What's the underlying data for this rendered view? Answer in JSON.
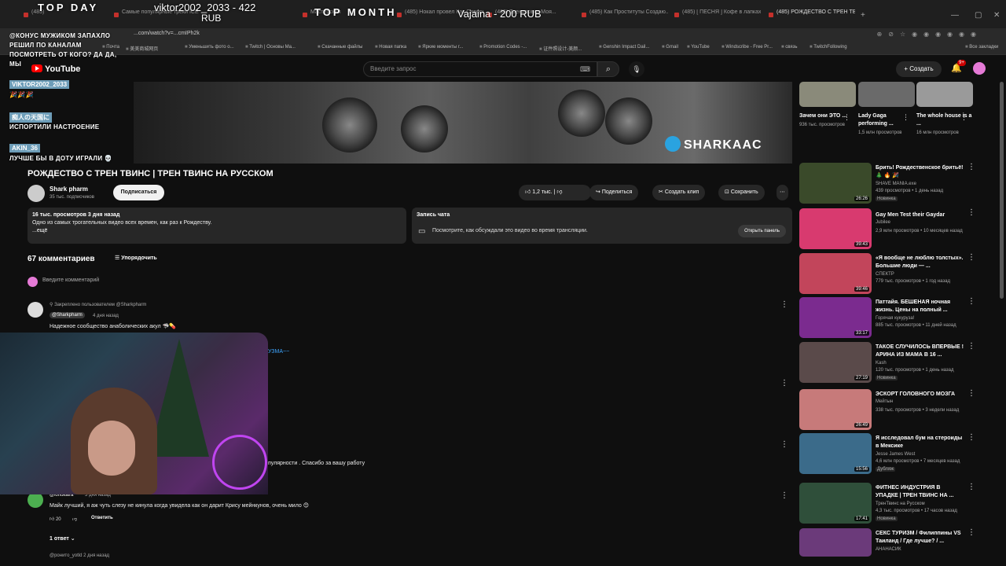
{
  "browser": {
    "tabs": [
      {
        "label": "(485)"
      },
      {
        "label": "Самые популярные треки ICE"
      },
      {
        "label": "Мастерская"
      },
      {
        "label": "(485) Насколько..."
      },
      {
        "label": "(485) Нокал провел Как Северный..."
      },
      {
        "label": "(485) Тренировка Моя..."
      },
      {
        "label": "(485) Как Проституты Создаю..."
      },
      {
        "label": "(485) [ ПЕСНЯ ] Кофе в лапках..."
      },
      {
        "label": "(485) РОЖДЕСТВО С ТРЕН ТВИН"
      }
    ],
    "address": "...com/watch?v=...cmIPh2k",
    "bookmarks": [
      "Почта",
      "美美商城网页",
      "Уменьшить фото о...",
      "Twitch | Основы Ma...",
      "Скачанные файлы",
      "Новая папка",
      "Яркие моменты г...",
      "Promotion Codes -...",
      "证件照设计-美颜...",
      "Genshin Impact Dail...",
      "Gmail",
      "YouTube",
      "Windscribe - Free Pr...",
      "связь",
      "TwitchFollowing",
      "Все закладки"
    ]
  },
  "youtube": {
    "logo": "YouTube",
    "search_placeholder": "Введите запрос",
    "create_label": "+ Создать",
    "notif_count": "9+"
  },
  "video": {
    "watermark": "SHARKAAC",
    "title": "РОЖДЕСТВО С ТРЕН ТВИНС | ТРЕН ТВИНС НА РУССКОМ",
    "channel": "Shark pharm",
    "subscribers": "35 тыс. подписчиков",
    "subscribe_label": "Подписаться",
    "likes": "1,2 тыс.",
    "share_label": "Поделиться",
    "clip_label": "Создать клип",
    "save_label": "Сохранить",
    "description": {
      "meta": "16 тыс. просмотров  3 дня назад",
      "text": "Одно из самых трогательных видео всех времен, как раз к Рождеству.",
      "more": "...ещё"
    },
    "chat_replay": {
      "title": "Запись чата",
      "text": "Посмотрите, как обсуждали это видео во время трансляции.",
      "button": "Открыть панель"
    }
  },
  "comments": {
    "count_label": "67 комментариев",
    "sort_label": "Упорядочить",
    "input_placeholder": "Введите комментарий",
    "pinned": {
      "pinned_by": "Закреплено пользователем @Sharkpharm",
      "author": "@Sharkpharm",
      "time": "4 дня назад",
      "text": "Надежное сообщество анаболических акул 🦈💊"
    },
    "partial_link": "УЗМА~~",
    "partial_text": "пулярности . Спасибо за вашу работу",
    "second": {
      "author": "@lorlokaira",
      "time": "3 дня назад",
      "text": "Майк лучший, я аж чуть слезу не кинула когда увидела как он дарит Криcу мейнкунов, очень мило 😊",
      "likes": "20",
      "reply_label": "Ответить",
      "replies_label": "1 ответ"
    },
    "third_author_partial": "@ронито_yotld  2 дня назад"
  },
  "shorts": [
    {
      "title": "Зачем они ЭТО ...",
      "views": "936 тыс. просмотров"
    },
    {
      "title": "Lady Gaga performing ...",
      "views": "1,5 млн просмотров"
    },
    {
      "title": "The whole house is a ...",
      "views": "16 млн просмотров"
    }
  ],
  "recommendations": [
    {
      "title": "Брить! Рождественское бритьё! 🎄 🔥 🎉",
      "channel": "SHAVE MANIA.exe",
      "meta": "439 просмотров • 1 день назад",
      "badge": "Новинка",
      "duration": "26:26",
      "color": "#3a4a2a"
    },
    {
      "title": "Gay Men Test their Gaydar",
      "channel": "Jubilee",
      "meta": "2,9 млн просмотров • 10 месяцев назад",
      "badge": "",
      "duration": "39:43",
      "color": "#d83a6f"
    },
    {
      "title": "«Я вообще не люблю толстых». Большие люди — ...",
      "channel": "СПЕКТР",
      "meta": "779 тыс. просмотров • 1 год назад",
      "badge": "",
      "duration": "39:46",
      "color": "#c2455b"
    },
    {
      "title": "Паттайя. БЕШЕНАЯ ночная жизнь. Цены на полный ...",
      "channel": "Горячая кукуруза!",
      "meta": "885 тыс. просмотров • 11 дней назад",
      "badge": "",
      "duration": "33:17",
      "color": "#7b2b8f"
    },
    {
      "title": "ТАКОЕ СЛУЧИЛОСЬ ВПЕРВЫЕ ! АРИНА ИЗ МАМА В 16 ...",
      "channel": "Kash",
      "meta": "120 тыс. просмотров • 1 день назад",
      "badge": "Новинка",
      "duration": "27:19",
      "color": "#5a4a4a"
    },
    {
      "title": "ЭСКОРТ ГОЛОВНОГО МОЗГА",
      "channel": "Мейтын",
      "meta": "338 тыс. просмотров • 3 недели назад",
      "badge": "",
      "duration": "26:49",
      "color": "#c77a7a"
    },
    {
      "title": "Я исследовал бум на стероиды в Мексике",
      "channel": "Jesse James West",
      "meta": "4,6 млн просмотров • 7 месяцев назад",
      "badge": "Дубляж",
      "duration": "15:56",
      "color": "#3b6b8a"
    },
    {
      "title": "ФИТНЕС ИНДУСТРИЯ В УПАДКЕ | ТРЕН ТВИНС НА ...",
      "channel": "ТренТвинс на Русском",
      "meta": "4,3 тыс. просмотров • 17 часов назад",
      "badge": "Новинка",
      "duration": "17:41",
      "color": "#2f4f3a"
    },
    {
      "title": "СЕКС ТУРИЗМ / Филиппины VS Таиланд / Где лучше? / ...",
      "channel": "АНАНАСИК",
      "meta": "",
      "badge": "",
      "duration": "",
      "color": "#6b3a7a"
    }
  ],
  "stream_overlay": {
    "banner_left": "TOP DAY",
    "banner_mid": "viktor2002_2033 - 422",
    "banner_mid_sub": "RUB",
    "banner_top_month": "TOP MONTH",
    "banner_right": "Vajaina - 200 RUB",
    "chat": [
      {
        "name": "",
        "msg1": "@КОНУС МУЖИКОМ ЗАПАХЛО",
        "msg2": "РЕШИЛ ПО КАНАЛАМ",
        "msg3": "ПОСМОТРЕТЬ ОТ КОГО? ДА ДА,",
        "msg4": "МЫ"
      },
      {
        "name": "VIKTOR2002_2033",
        "msg1": "🎉🎉🎉"
      },
      {
        "name": "痴人の天国に",
        "msg1": "ИСПОРТИЛИ НАСТРОЕНИЕ"
      },
      {
        "name": "AKIN_36",
        "msg1": "ЛУЧШЕ БЫ В ДОТУ ИГРАЛИ 💀"
      }
    ]
  }
}
